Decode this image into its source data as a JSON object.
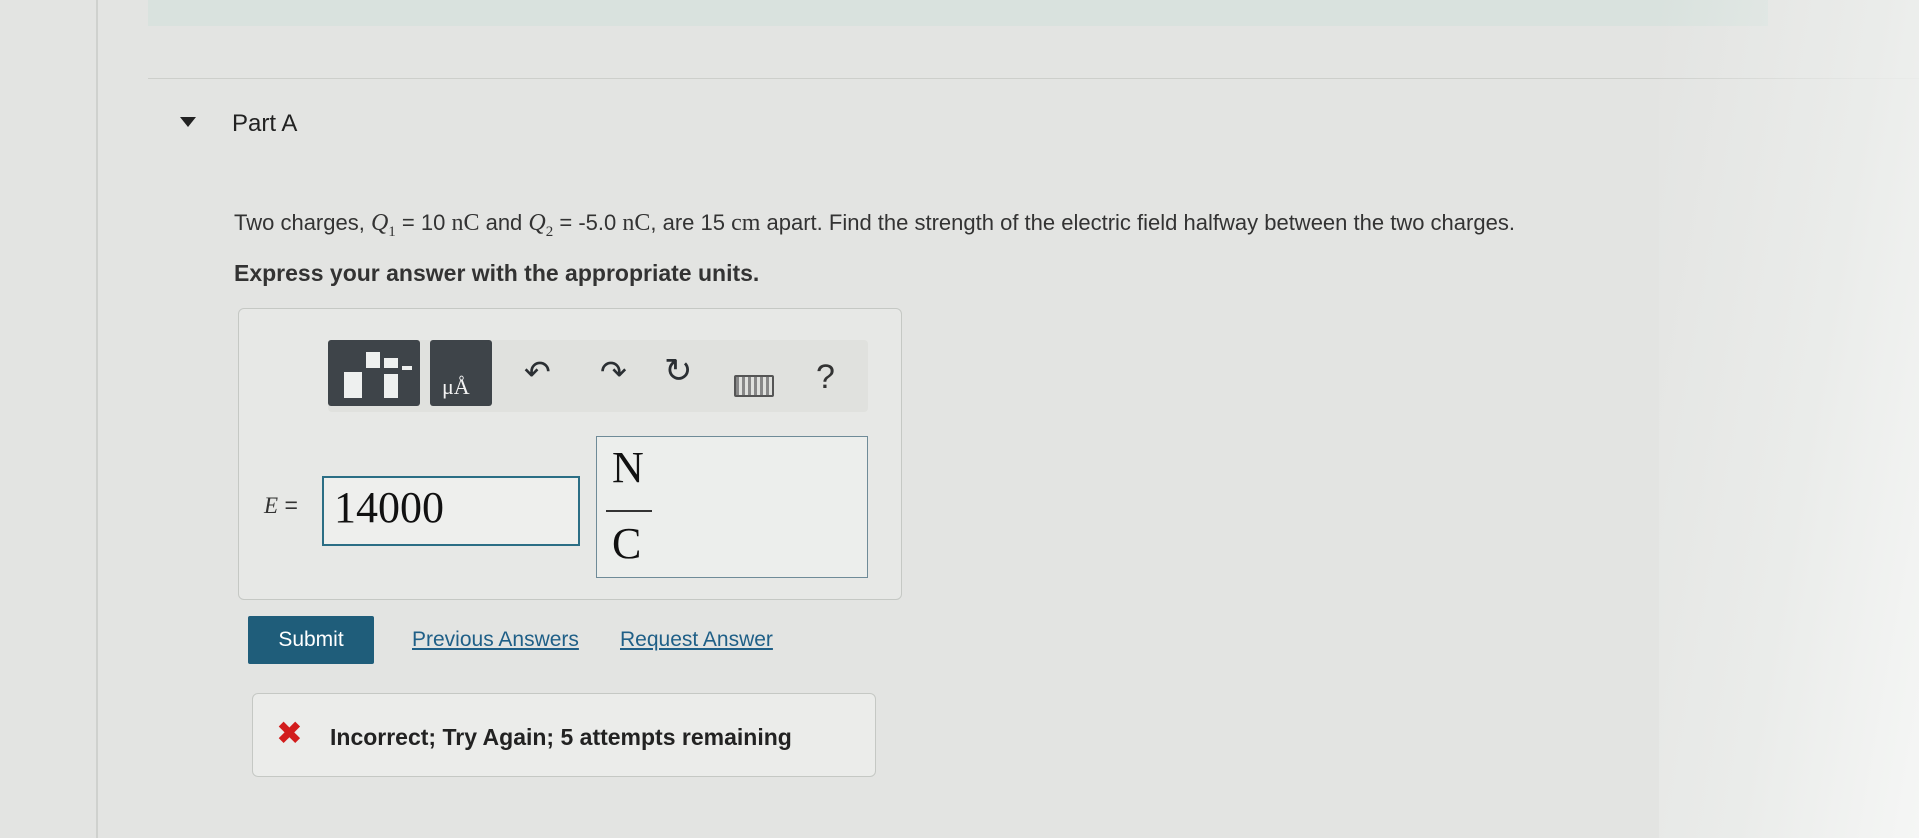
{
  "part": {
    "title": "Part A"
  },
  "question": {
    "prefix": "Two charges, ",
    "q1_symbol": "Q",
    "q1_sub": "1",
    "q1_eq": " = 10 ",
    "q1_unit": "nC",
    "and": " and ",
    "q2_symbol": "Q",
    "q2_sub": "2",
    "q2_eq": " = -5.0 ",
    "q2_unit": "nC",
    "mid": ", are 15 ",
    "dist_unit": "cm",
    "suffix": " apart. Find the strength of the electric field halfway between the two charges.",
    "instruction": "Express your answer with the appropriate units."
  },
  "toolbar": {
    "units_glyph": "μÅ",
    "undo_icon": "undo-icon",
    "redo_icon": "redo-icon",
    "reset_icon": "reset-icon",
    "keyboard_icon": "keyboard-icon",
    "help_label": "?"
  },
  "answer": {
    "variable": "E",
    "equals": " =",
    "value": "14000",
    "unit_numerator": "N",
    "unit_denominator": "C"
  },
  "actions": {
    "submit_label": "Submit",
    "previous_answers_label": "Previous Answers",
    "request_answer_label": "Request Answer"
  },
  "feedback": {
    "icon": "✖",
    "text": "Incorrect; Try Again; 5 attempts remaining"
  },
  "colors": {
    "submit_bg": "#1f5d7a",
    "link": "#1f5f87",
    "error": "#d21c1c"
  }
}
